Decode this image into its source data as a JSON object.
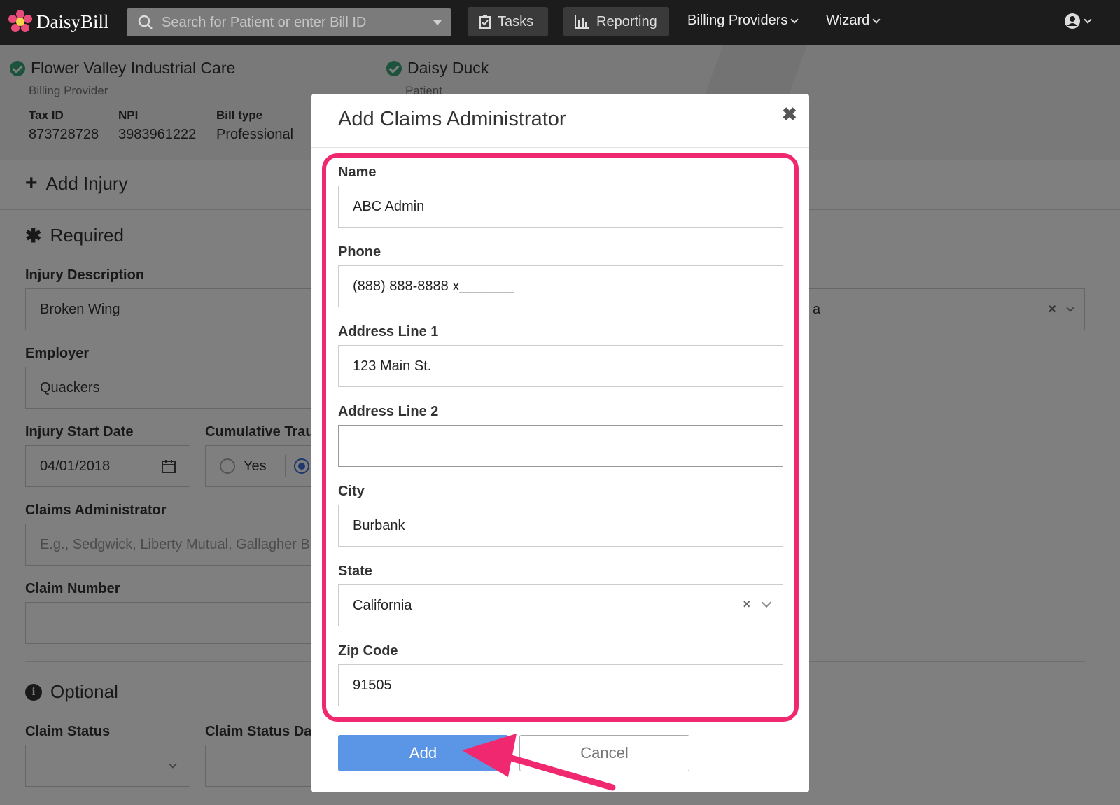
{
  "nav": {
    "brand": "DaisyBill",
    "search_placeholder": "Search for Patient or enter Bill ID",
    "tasks": "Tasks",
    "reporting": "Reporting",
    "billing_providers": "Billing Providers",
    "wizard": "Wizard"
  },
  "header": {
    "provider_name": "Flower Valley Industrial Care",
    "provider_sub": "Billing Provider",
    "tax_id_label": "Tax ID",
    "tax_id": "873728728",
    "npi_label": "NPI",
    "npi": "3983961222",
    "bill_type_label": "Bill type",
    "bill_type": "Professional",
    "patient_name": "Daisy Duck",
    "patient_sub": "Patient"
  },
  "form": {
    "add_injury": "Add Injury",
    "required": "Required",
    "injury_description_label": "Injury Description",
    "injury_description": "Broken Wing",
    "employer_label": "Employer",
    "employer": "Quackers",
    "injury_start_label": "Injury Start Date",
    "injury_start": "04/01/2018",
    "cumulative_label": "Cumulative Trau",
    "yes": "Yes",
    "claims_admin_label": "Claims Administrator",
    "claims_admin_placeholder": "E.g., Sedgwick, Liberty Mutual, Gallagher B",
    "claim_number_label": "Claim Number",
    "optional": "Optional",
    "claim_status_label": "Claim Status",
    "claim_status_date_label": "Claim Status Dat",
    "right_select_fragment": "a"
  },
  "modal": {
    "title": "Add Claims Administrator",
    "close": "✖",
    "name_label": "Name",
    "name": "ABC Admin",
    "phone_label": "Phone",
    "phone": "(888) 888-8888 x_______",
    "address1_label": "Address Line 1",
    "address1": "123 Main St.",
    "address2_label": "Address Line 2",
    "address2": "",
    "city_label": "City",
    "city": "Burbank",
    "state_label": "State",
    "state": "California",
    "zip_label": "Zip Code",
    "zip": "91505",
    "add_button": "Add",
    "cancel_button": "Cancel"
  },
  "colors": {
    "highlight": "#f0286f",
    "primary": "#5a95e6",
    "nav_bg": "#1c1c1c",
    "check": "#3aa57a"
  }
}
